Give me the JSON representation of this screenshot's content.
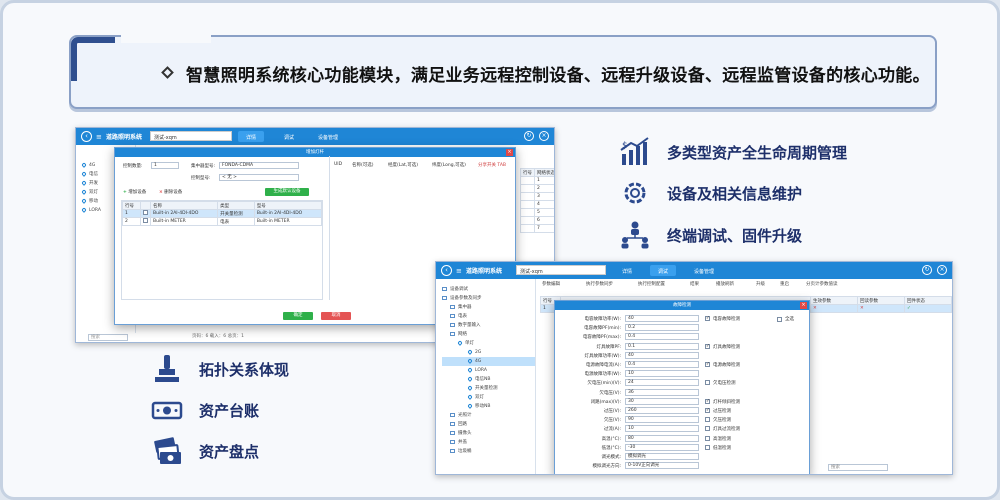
{
  "banner": {
    "text": "智慧照明系统核心功能模块，满足业务远程控制设备、远程升级设备、远程监管设备的核心功能。"
  },
  "features_right": [
    {
      "icon": "asset-growth-chart-icon",
      "label": "多类型资产全生命周期管理"
    },
    {
      "icon": "gear-icon",
      "label": "设备及相关信息维护"
    },
    {
      "icon": "people-network-icon",
      "label": "终端调试、固件升级"
    }
  ],
  "features_left": [
    {
      "icon": "stamp-icon",
      "label": "拓扑关系体现"
    },
    {
      "icon": "money-icon",
      "label": "资产台账"
    },
    {
      "icon": "cash-stack-icon",
      "label": "资产盘点"
    }
  ],
  "window1": {
    "app_name": "道路照明系统",
    "project_select": "测试-xqm",
    "tabs": [
      "详情",
      "调试",
      "设备管理"
    ],
    "active_tab": 0,
    "tree": [
      {
        "label": "4G",
        "selected": false
      },
      {
        "label": "电信",
        "selected": false
      },
      {
        "label": "开发",
        "selected": false
      },
      {
        "label": "双灯",
        "selected": false
      },
      {
        "label": "移动",
        "selected": false
      },
      {
        "label": "LORA",
        "selected": false
      }
    ],
    "right_col_header": [
      "行号",
      "网络状态"
    ],
    "right_col_values": [
      "1",
      "2",
      "3",
      "4",
      "5",
      "6",
      "7"
    ],
    "status_bar": "页码：6   载入：6   总页：1",
    "search_placeholder": "搜索",
    "dialog": {
      "title": "增加灯杆",
      "batch_label": "控制数量:",
      "batch_value": "1",
      "type_label": "集中器型号:",
      "type_value": "FONDA-CDMA",
      "ctrl_label": "控制型号:",
      "ctrl_value": "< 无 >",
      "btn_add": "增加设备",
      "btn_delete": "删除设备",
      "btn_generate": "生成默认设备",
      "table_headers": [
        "行号",
        "名称",
        "类型",
        "型号"
      ],
      "rows": [
        {
          "no": "1",
          "name": "Built-in 2AI-4DI-4DO",
          "type": "开关量检测",
          "model": "Built-in 2AI-4DI-4DO",
          "selected": true
        },
        {
          "no": "2",
          "name": "Built-in METER",
          "type": "电表",
          "model": "Built-in METER",
          "selected": false
        }
      ],
      "right_headers": [
        "UID",
        "名称(可选)",
        "经度(Lat,可选)",
        "纬度(Long,可选)"
      ],
      "right_hint": "分享开关 TAB",
      "ok": "确定",
      "cancel": "取消"
    }
  },
  "window2": {
    "app_name": "道路照明系统",
    "project_select": "测试-xqm",
    "tabs": [
      "详情",
      "调试",
      "设备管理"
    ],
    "active_tab": 1,
    "toolbar": [
      "参数编辑",
      "执行参数同步",
      "执行控制配置",
      "结果",
      "播放刷新",
      "升级",
      "重启",
      "分页计参数值读"
    ],
    "tree": [
      {
        "label": "设备调试",
        "level": 0
      },
      {
        "label": "设备参数及同步",
        "level": 0
      },
      {
        "label": "集中器",
        "level": 1
      },
      {
        "label": "电表",
        "level": 1
      },
      {
        "label": "数字量输入",
        "level": 1
      },
      {
        "label": "网络",
        "level": 1
      },
      {
        "label": "单灯",
        "level": 2
      },
      {
        "label": "2G",
        "level": 3
      },
      {
        "label": "4G",
        "level": 3,
        "selected": true
      },
      {
        "label": "LORA",
        "level": 3
      },
      {
        "label": "电信NB",
        "level": 3
      },
      {
        "label": "开关量检测",
        "level": 3
      },
      {
        "label": "双灯",
        "level": 3
      },
      {
        "label": "移动NB",
        "level": 3
      },
      {
        "label": "光照计",
        "level": 1
      },
      {
        "label": "回路",
        "level": 1
      },
      {
        "label": "摄像头",
        "level": 1
      },
      {
        "label": "井盖",
        "level": 1
      },
      {
        "label": "垃圾桶",
        "level": 1
      }
    ],
    "right_headers": [
      "行号",
      "生效参数",
      "回读参数",
      "回件状态"
    ],
    "status_search": "搜索",
    "dialog": {
      "title": "故障检测",
      "fields": [
        {
          "label": "电容故障功率(W):",
          "value": "40",
          "check": "电容故障检测",
          "checked": true
        },
        {
          "label": "电容故障PF(min):",
          "value": "0.2",
          "check": "",
          "checked": false
        },
        {
          "label": "电容故障PF(max):",
          "value": "0.4",
          "check": "",
          "checked": false
        },
        {
          "label": "灯具故障PF:",
          "value": "0.1",
          "check": "灯具故障检测",
          "checked": true
        },
        {
          "label": "灯具故障功率(W):",
          "value": "40",
          "check": "",
          "checked": false
        },
        {
          "label": "电源故障电流(A):",
          "value": "0.4",
          "check": "电源故障检测",
          "checked": true
        },
        {
          "label": "电源故障功率(W):",
          "value": "10",
          "check": "",
          "checked": false
        },
        {
          "label": "欠电压(min)(V):",
          "value": "24",
          "check": "欠电压检测",
          "checked": false
        },
        {
          "label": "欠电压(V):",
          "value": "36",
          "check": "",
          "checked": false
        },
        {
          "label": "闭路(max)(V):",
          "value": "30",
          "check": "灯杆倾斜检测",
          "checked": true
        },
        {
          "label": "过压(V):",
          "value": "260",
          "check": "过压检测",
          "checked": true
        },
        {
          "label": "欠压(V):",
          "value": "90",
          "check": "欠压检测",
          "checked": false
        },
        {
          "label": "过流(A):",
          "value": "10",
          "check": "灯具过流检测",
          "checked": false
        },
        {
          "label": "高温(°C):",
          "value": "80",
          "check": "高温检测",
          "checked": false
        },
        {
          "label": "低温(°C):",
          "value": "-30",
          "check": "低温检测",
          "checked": false
        },
        {
          "label": "调光模式:",
          "value": "模拟调光",
          "check": "",
          "checked": false
        },
        {
          "label": "模拟调光方向:",
          "value": "0-10V正向调光",
          "check": "",
          "checked": false
        }
      ],
      "side_check": "全选"
    }
  }
}
